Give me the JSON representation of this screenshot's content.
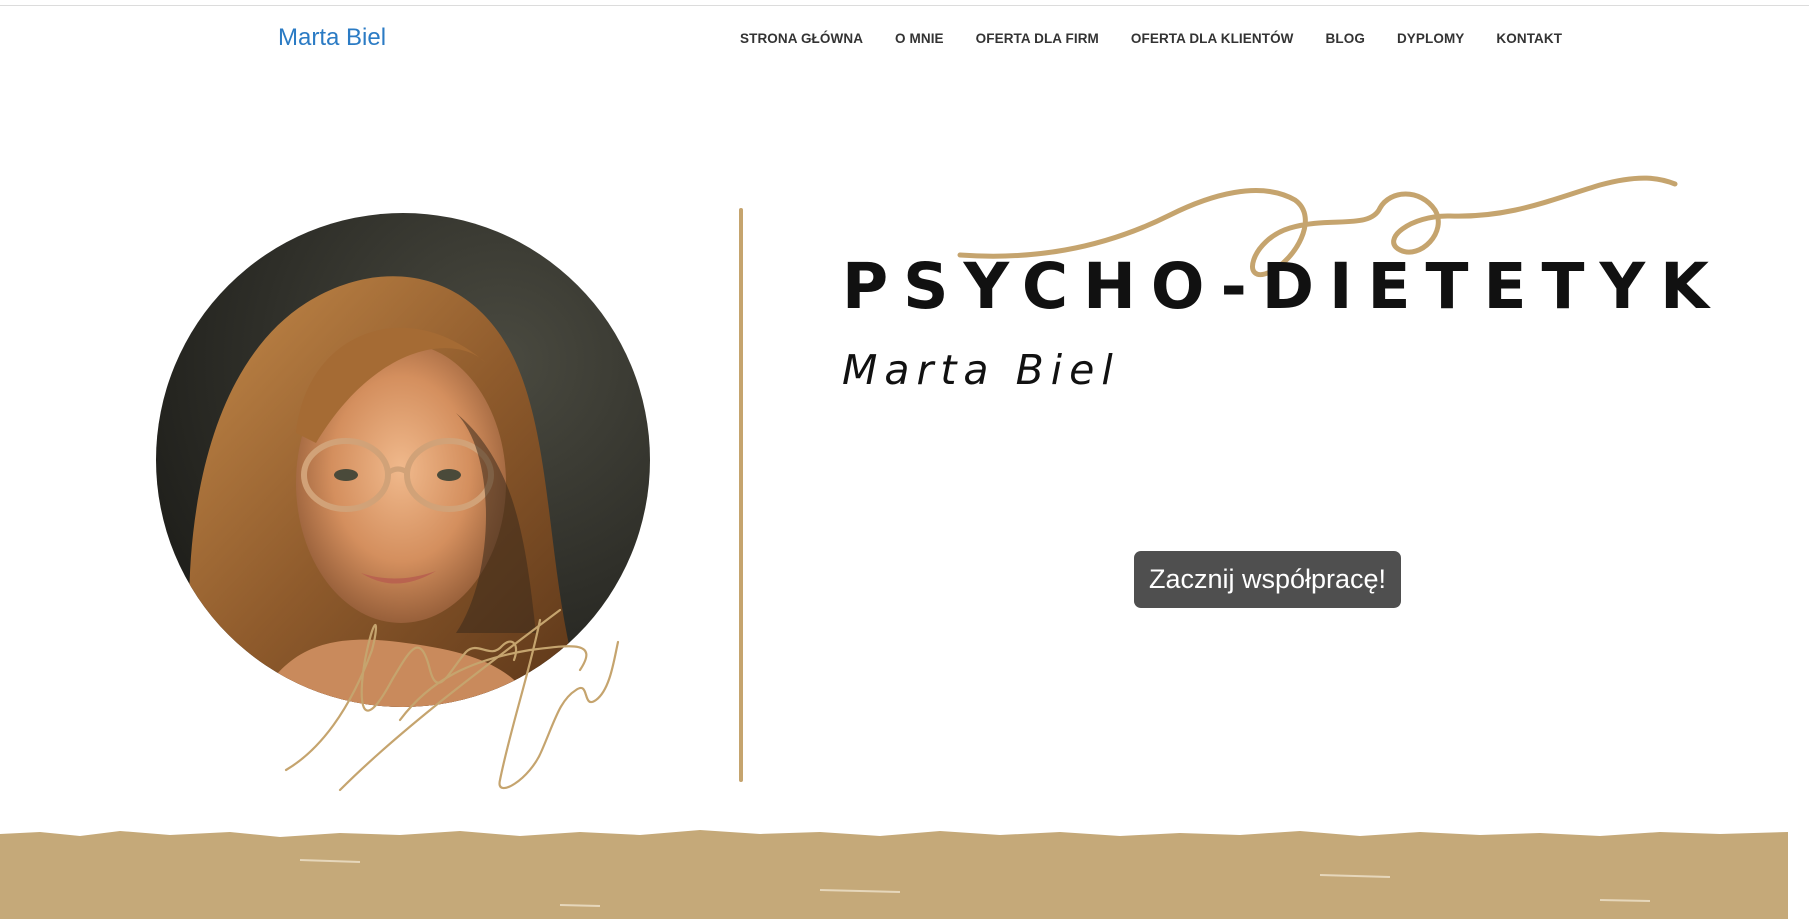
{
  "header": {
    "logo_text": "Marta Biel",
    "nav": [
      "STRONA GŁÓWNA",
      "O MNIE",
      "OFERTA DLA FIRM",
      "OFERTA DLA KLIENTÓW",
      "BLOG",
      "DYPLOMY",
      "KONTAKT"
    ]
  },
  "hero": {
    "title": "PSYCHO-DIETETYK",
    "subtitle": "Marta Biel",
    "cta_label": "Zacznij współpracę!"
  },
  "colors": {
    "brand_blue": "#2b7bc4",
    "accent_gold": "#c5a46e",
    "button_gray": "#4f4f4f",
    "text_dark": "#111111"
  }
}
